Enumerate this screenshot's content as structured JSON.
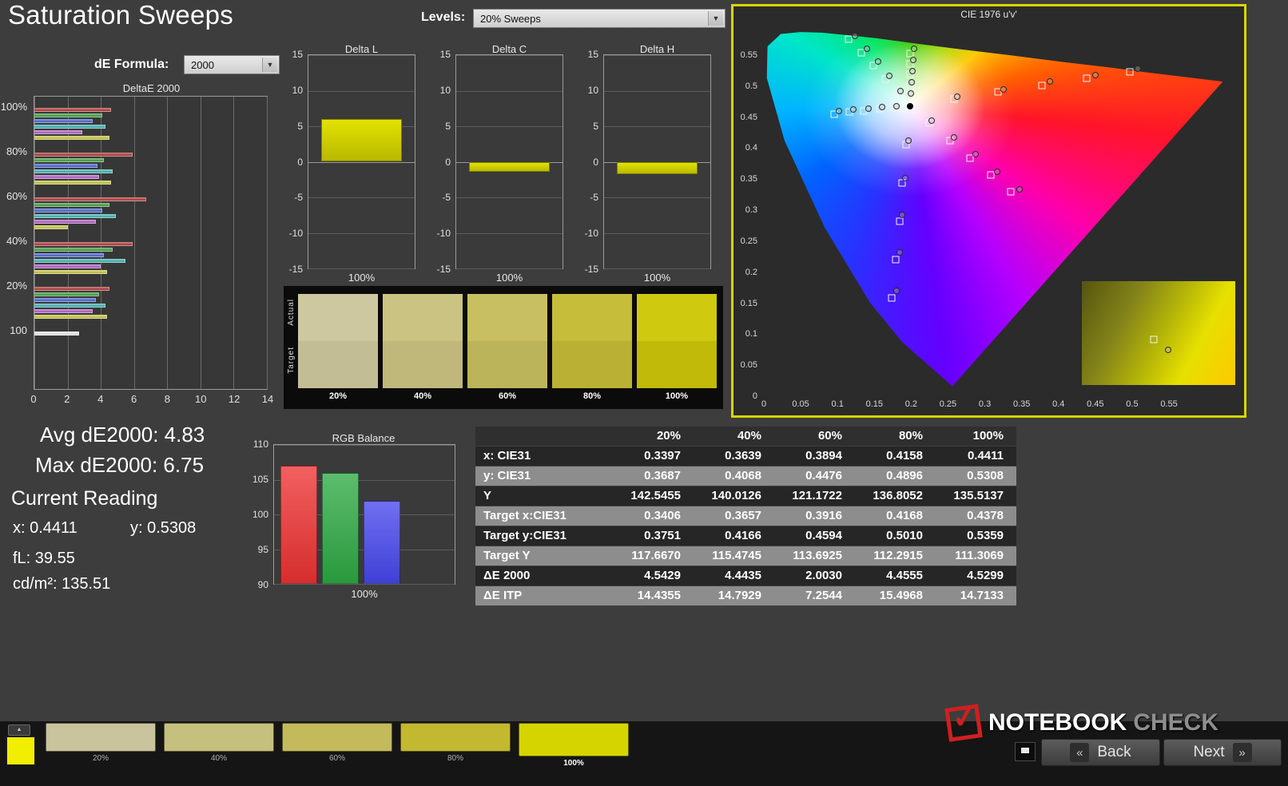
{
  "app": {
    "title": "Saturation Sweeps",
    "levels_label": "Levels:",
    "levels_value": "20% Sweeps",
    "formula_label": "dE Formula:",
    "formula_value": "2000"
  },
  "icons": {
    "dropdown_arrow": "▼"
  },
  "colors": {
    "accent_yellow": "#d6d600",
    "background": "#3d3d3d"
  },
  "stats": {
    "avg": "Avg dE2000: 4.83",
    "max": "Max dE2000: 6.75",
    "current_reading": "Current Reading",
    "x": "x: 0.4411",
    "y": "y: 0.5308",
    "fl": "fL: 39.55",
    "cdm2": "cd/m²: 135.51"
  },
  "compare": {
    "row_labels": [
      "Actual",
      "Target"
    ],
    "labels": [
      "20%",
      "40%",
      "60%",
      "80%",
      "100%"
    ],
    "actual": [
      "#cdc8a0",
      "#cac382",
      "#c7bf61",
      "#c6bd3a",
      "#cfca10"
    ],
    "target": [
      "#c2bd95",
      "#bfb87a",
      "#bcb45a",
      "#bab134",
      "#c1ba08"
    ]
  },
  "bottom_strip": {
    "up_arrow": "▲",
    "corner_color": "#f2ee00",
    "swatches": [
      {
        "label": "20%",
        "color": "#c9c49c",
        "active": false
      },
      {
        "label": "40%",
        "color": "#c6c07e",
        "active": false
      },
      {
        "label": "60%",
        "color": "#c3ba5c",
        "active": false
      },
      {
        "label": "80%",
        "color": "#c2b931",
        "active": false
      },
      {
        "label": "100%",
        "color": "#d6d400",
        "active": true
      }
    ]
  },
  "logo": {
    "check": "✓",
    "part1": "NOTEBOOK",
    "part2": "CHECK"
  },
  "nav": {
    "back": "Back",
    "next": "Next",
    "back_chevron": "«",
    "next_chevron": "»"
  },
  "chart_data": [
    {
      "id": "deltae2000",
      "type": "bar",
      "orientation": "horizontal",
      "title": "DeltaE 2000",
      "xlim": [
        0,
        14
      ],
      "xticks": [
        0,
        2,
        4,
        6,
        8,
        10,
        12,
        14
      ],
      "colors": [
        "#b03434",
        "#3f9e3f",
        "#4663d2",
        "#3fb3b3",
        "#b45cc8",
        "#c8c83c"
      ],
      "groups": [
        {
          "label": "100%",
          "values": [
            4.6,
            4.1,
            3.5,
            4.3,
            2.9,
            4.5
          ]
        },
        {
          "label": "80%",
          "values": [
            5.9,
            4.2,
            3.8,
            4.7,
            3.9,
            4.6
          ]
        },
        {
          "label": "60%",
          "values": [
            6.75,
            4.5,
            4.1,
            4.9,
            3.7,
            2.0
          ]
        },
        {
          "label": "40%",
          "values": [
            5.9,
            4.7,
            4.2,
            5.5,
            4.0,
            4.4
          ]
        },
        {
          "label": "20%",
          "values": [
            4.5,
            3.9,
            3.7,
            4.3,
            3.5,
            4.4
          ]
        },
        {
          "label": "100",
          "values": [
            2.7
          ],
          "colors": [
            "#ececec"
          ]
        }
      ]
    },
    {
      "id": "delta_l",
      "el": "delta-l",
      "type": "bar",
      "title": "Delta L",
      "categories": [
        "100%"
      ],
      "values": [
        6.0
      ],
      "ylim": [
        -15,
        15
      ],
      "yticks": [
        15,
        10,
        5,
        0,
        -5,
        -10,
        -15
      ],
      "xlabel": "100%"
    },
    {
      "id": "delta_c",
      "el": "delta-c",
      "type": "bar",
      "title": "Delta C",
      "categories": [
        "100%"
      ],
      "values": [
        -1.4
      ],
      "ylim": [
        -15,
        15
      ],
      "yticks": [
        15,
        10,
        5,
        0,
        -5,
        -10,
        -15
      ],
      "xlabel": "100%"
    },
    {
      "id": "delta_h",
      "el": "delta-h",
      "type": "bar",
      "title": "Delta H",
      "categories": [
        "100%"
      ],
      "values": [
        -1.7
      ],
      "ylim": [
        -15,
        15
      ],
      "yticks": [
        15,
        10,
        5,
        0,
        -5,
        -10,
        -15
      ],
      "xlabel": "100%"
    },
    {
      "id": "rgb_balance",
      "type": "bar",
      "title": "RGB Balance",
      "categories": [
        "Red",
        "Green",
        "Blue"
      ],
      "values": [
        107,
        106,
        102
      ],
      "colors": [
        "#ee3333",
        "#2eaa44",
        "#4747ee"
      ],
      "ylim": [
        90,
        110
      ],
      "yticks": [
        110,
        105,
        100,
        95,
        90
      ],
      "xlabel": "100%"
    },
    {
      "id": "cie",
      "type": "scatter",
      "title": "CIE 1976 u'v'",
      "xmax": 0.64,
      "ymax": 0.6,
      "xticks": [
        {
          "v": 0,
          "l": "0"
        },
        {
          "v": 0.05,
          "l": "0.05"
        },
        {
          "v": 0.1,
          "l": "0.1"
        },
        {
          "v": 0.15,
          "l": "0.15"
        },
        {
          "v": 0.2,
          "l": "0.2"
        },
        {
          "v": 0.25,
          "l": "0.25"
        },
        {
          "v": 0.3,
          "l": "0.3"
        },
        {
          "v": 0.35,
          "l": "0.35"
        },
        {
          "v": 0.4,
          "l": "0.4"
        },
        {
          "v": 0.45,
          "l": "0.45"
        },
        {
          "v": 0.5,
          "l": "0.5"
        },
        {
          "v": 0.55,
          "l": "0.55"
        }
      ],
      "yticks": [
        {
          "v": 0.55,
          "l": "0.55"
        },
        {
          "v": 0.5,
          "l": "0.5"
        },
        {
          "v": 0.45,
          "l": "0.45"
        },
        {
          "v": 0.4,
          "l": "0.4"
        },
        {
          "v": 0.35,
          "l": "0.35"
        },
        {
          "v": 0.3,
          "l": "0.3"
        },
        {
          "v": 0.25,
          "l": "0.25"
        },
        {
          "v": 0.2,
          "l": "0.2"
        },
        {
          "v": 0.15,
          "l": "0.15"
        },
        {
          "v": 0.1,
          "l": "0.1"
        },
        {
          "v": 0.05,
          "l": "0.05"
        },
        {
          "v": 0,
          "l": "0"
        }
      ],
      "locus": [
        [
          0.256,
          0.016
        ],
        [
          0.188,
          0.087
        ],
        [
          0.144,
          0.151
        ],
        [
          0.083,
          0.271
        ],
        [
          0.028,
          0.412
        ],
        [
          0.004,
          0.513
        ],
        [
          0.005,
          0.564
        ],
        [
          0.023,
          0.584
        ],
        [
          0.05,
          0.587
        ],
        [
          0.079,
          0.586
        ],
        [
          0.113,
          0.582
        ],
        [
          0.153,
          0.577
        ],
        [
          0.203,
          0.569
        ],
        [
          0.262,
          0.56
        ],
        [
          0.332,
          0.55
        ],
        [
          0.404,
          0.539
        ],
        [
          0.469,
          0.53
        ],
        [
          0.52,
          0.522
        ],
        [
          0.583,
          0.513
        ],
        [
          0.623,
          0.507
        ]
      ],
      "white_point": [
        0.198,
        0.468
      ],
      "targets": [
        [
          0.258,
          0.479
        ],
        [
          0.318,
          0.49
        ],
        [
          0.378,
          0.501
        ],
        [
          0.438,
          0.512
        ],
        [
          0.497,
          0.523
        ],
        [
          0.182,
          0.489
        ],
        [
          0.165,
          0.511
        ],
        [
          0.149,
          0.533
        ],
        [
          0.132,
          0.554
        ],
        [
          0.115,
          0.576
        ],
        [
          0.193,
          0.406
        ],
        [
          0.188,
          0.344
        ],
        [
          0.184,
          0.282
        ],
        [
          0.179,
          0.22
        ],
        [
          0.174,
          0.158
        ],
        [
          0.177,
          0.465
        ],
        [
          0.157,
          0.463
        ],
        [
          0.136,
          0.46
        ],
        [
          0.116,
          0.458
        ],
        [
          0.095,
          0.455
        ],
        [
          0.225,
          0.44
        ],
        [
          0.253,
          0.412
        ],
        [
          0.28,
          0.384
        ],
        [
          0.308,
          0.357
        ],
        [
          0.335,
          0.329
        ],
        [
          0.198,
          0.485
        ],
        [
          0.198,
          0.502
        ],
        [
          0.198,
          0.519
        ],
        [
          0.199,
          0.536
        ],
        [
          0.199,
          0.553
        ]
      ],
      "measurements": [
        [
          0.262,
          0.483
        ],
        [
          0.325,
          0.495
        ],
        [
          0.388,
          0.507
        ],
        [
          0.45,
          0.518
        ],
        [
          0.508,
          0.528
        ],
        [
          0.185,
          0.492
        ],
        [
          0.17,
          0.516
        ],
        [
          0.155,
          0.54
        ],
        [
          0.14,
          0.56
        ],
        [
          0.124,
          0.581
        ],
        [
          0.196,
          0.412
        ],
        [
          0.192,
          0.352
        ],
        [
          0.188,
          0.292
        ],
        [
          0.184,
          0.232
        ],
        [
          0.18,
          0.17
        ],
        [
          0.18,
          0.468
        ],
        [
          0.161,
          0.466
        ],
        [
          0.142,
          0.464
        ],
        [
          0.122,
          0.462
        ],
        [
          0.102,
          0.46
        ],
        [
          0.228,
          0.444
        ],
        [
          0.258,
          0.417
        ],
        [
          0.287,
          0.39
        ],
        [
          0.317,
          0.362
        ],
        [
          0.347,
          0.334
        ],
        [
          0.2,
          0.488
        ],
        [
          0.201,
          0.506
        ],
        [
          0.202,
          0.524
        ],
        [
          0.203,
          0.542
        ],
        [
          0.204,
          0.56
        ]
      ]
    },
    {
      "id": "results",
      "type": "table",
      "columns": [
        "",
        "20%",
        "40%",
        "60%",
        "80%",
        "100%"
      ],
      "rows": [
        {
          "label": "x: CIE31",
          "values": [
            "0.3397",
            "0.3639",
            "0.3894",
            "0.4158",
            "0.4411"
          ]
        },
        {
          "label": "y: CIE31",
          "values": [
            "0.3687",
            "0.4068",
            "0.4476",
            "0.4896",
            "0.5308"
          ]
        },
        {
          "label": "Y",
          "values": [
            "142.5455",
            "140.0126",
            "121.1722",
            "136.8052",
            "135.5137"
          ]
        },
        {
          "label": "Target x:CIE31",
          "values": [
            "0.3406",
            "0.3657",
            "0.3916",
            "0.4168",
            "0.4378"
          ]
        },
        {
          "label": "Target y:CIE31",
          "values": [
            "0.3751",
            "0.4166",
            "0.4594",
            "0.5010",
            "0.5359"
          ]
        },
        {
          "label": "Target Y",
          "values": [
            "117.6670",
            "115.4745",
            "113.6925",
            "112.2915",
            "111.3069"
          ]
        },
        {
          "label": "ΔE 2000",
          "values": [
            "4.5429",
            "4.4435",
            "2.0030",
            "4.4555",
            "4.5299"
          ]
        },
        {
          "label": "ΔE ITP",
          "values": [
            "14.4355",
            "14.7929",
            "7.2544",
            "15.4968",
            "14.7133"
          ]
        }
      ]
    }
  ]
}
